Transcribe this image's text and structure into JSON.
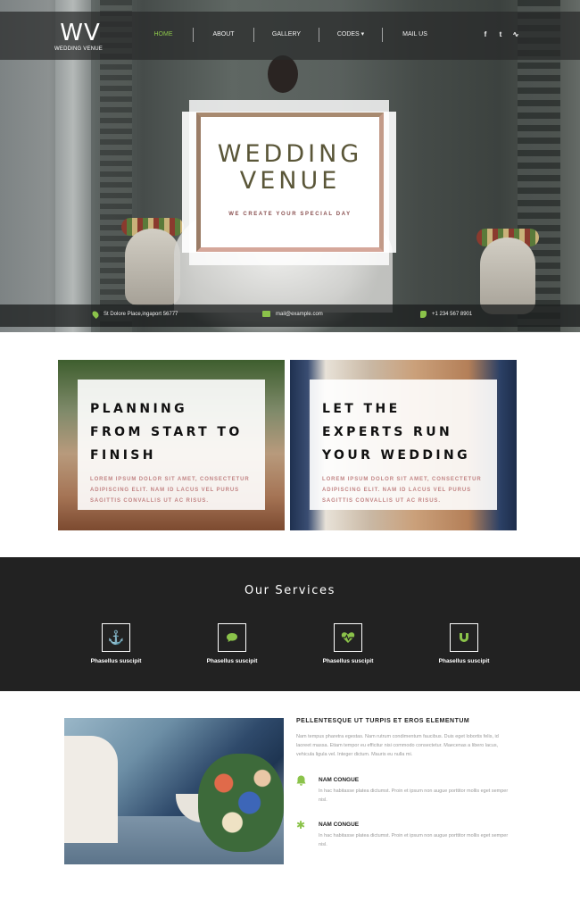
{
  "header": {
    "logo_mark": "WV",
    "logo_text": "WEDDING VENUE",
    "menu": [
      {
        "label": "HOME",
        "active": true
      },
      {
        "label": "ABOUT",
        "active": false
      },
      {
        "label": "GALLERY",
        "active": false
      },
      {
        "label": "CODES ▾",
        "active": false
      },
      {
        "label": "MAIL US",
        "active": false
      }
    ],
    "social": [
      {
        "icon": "facebook-icon",
        "glyph": "f"
      },
      {
        "icon": "twitter-icon",
        "glyph": "t"
      },
      {
        "icon": "rss-icon",
        "glyph": "∿"
      }
    ]
  },
  "hero": {
    "title_line1": "WEDDING",
    "title_line2": "VENUE",
    "subtitle": "WE CREATE YOUR SPECIAL DAY"
  },
  "contact": {
    "address": "St Dolore Place,ingaport 56777",
    "email": "mail@example.com",
    "phone": "+1 234 567 8901"
  },
  "features": [
    {
      "title": [
        "PLANNING",
        "FROM START TO",
        "FINISH"
      ],
      "text": [
        "LOREM IPSUM DOLOR SIT AMET, CONSECTETUR",
        "ADIPISCING ELIT. NAM ID LACUS VEL PURUS",
        "SAGITTIS CONVALLIS UT AC RISUS."
      ]
    },
    {
      "title": [
        "LET THE",
        "EXPERTS RUN",
        "YOUR WEDDING"
      ],
      "text": [
        "LOREM IPSUM DOLOR SIT AMET, CONSECTETUR",
        "ADIPISCING ELIT. NAM ID LACUS VEL PURUS",
        "SAGITTIS CONVALLIS UT AC RISUS."
      ]
    }
  ],
  "services": {
    "title": "Our Services",
    "items": [
      {
        "icon": "anchor-icon",
        "glyph": "⚓",
        "label": "Phasellus suscipit"
      },
      {
        "icon": "chat-icon",
        "glyph": "💬",
        "label": "Phasellus suscipit"
      },
      {
        "icon": "heartbeat-icon",
        "glyph": "♥",
        "label": "Phasellus suscipit"
      },
      {
        "icon": "magnet-icon",
        "glyph": "U",
        "label": "Phasellus suscipit"
      }
    ]
  },
  "about": {
    "title": "PELLENTESQUE UT TURPIS ET EROS ELEMENTUM",
    "text": "Nam tempus pharetra egestas. Nam rutrum condimentum faucibus. Duis eget lobortis felis, id laoreet massa. Etiam tempor eu efficitur nisi commodo consectetur. Maecenas a libero lacus, vehicula ligula vel. Integer dictum. Mauris eu nulla mi.",
    "points": [
      {
        "icon": "bell-icon",
        "glyph": "🔔",
        "title": "NAM CONGUE",
        "text": "In hac habitasse platea dictumst. Proin et ipsum non augue porttitor mollis eget semper nisl."
      },
      {
        "icon": "asterisk-icon",
        "glyph": "✱",
        "title": "NAM CONGUE",
        "text": "In hac habitasse platea dictumst. Proin et ipsum non augue porttitor mollis eget semper nisl."
      }
    ]
  },
  "colors": {
    "accent": "#8bc34a",
    "dark": "#222222",
    "pink_text": "#c28585"
  }
}
